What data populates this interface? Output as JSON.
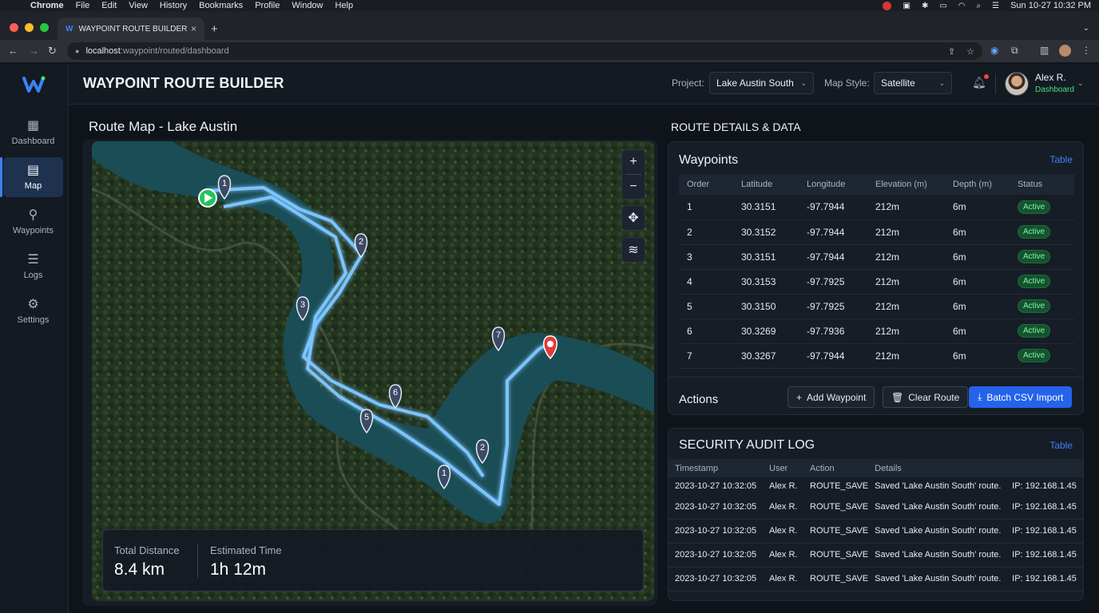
{
  "menubar": {
    "app": "Chrome",
    "items": [
      "File",
      "Edit",
      "View",
      "History",
      "Bookmarks",
      "Profile",
      "Window",
      "Help"
    ],
    "clock": "Sun 10-27  10:32 PM"
  },
  "browser": {
    "tab_title": "WAYPOINT ROUTE BUILDER",
    "url_host": "localhost",
    "url_path": ":waypoint/routed/dashboard"
  },
  "app": {
    "title": "WAYPOINT ROUTE BUILDER",
    "project_label": "Project:",
    "project_value": "Lake Austin South",
    "mapstyle_label": "Map Style:",
    "mapstyle_value": "Satellite",
    "user_name": "Alex R.",
    "user_role": "Dashboard"
  },
  "sidebar": {
    "items": [
      {
        "label": "Dashboard",
        "icon": "dashboard-icon"
      },
      {
        "label": "Map",
        "icon": "map-icon"
      },
      {
        "label": "Waypoints",
        "icon": "location-pin-icon"
      },
      {
        "label": "Logs",
        "icon": "document-icon"
      },
      {
        "label": "Settings",
        "icon": "gear-icon"
      }
    ]
  },
  "map_panel": {
    "title": "Route Map - Lake Austin",
    "total_distance_label": "Total Distance",
    "total_distance_value": "8.4 km",
    "est_time_label": "Estimated Time",
    "est_time_value": "1h 12m",
    "marker_labels": [
      "1",
      "2",
      "3",
      "7",
      "6",
      "5",
      "2",
      "1"
    ]
  },
  "details": {
    "title": "ROUTE DETAILS & DATA",
    "waypoints_title": "Waypoints",
    "waypoints_link": "Table",
    "columns": [
      "Order",
      "Latitude",
      "Longitude",
      "Elevation (m)",
      "Depth (m)",
      "Status"
    ],
    "rows": [
      [
        "1",
        "30.3151",
        "-97.7944",
        "212m",
        "6m",
        "Active"
      ],
      [
        "2",
        "30.3152",
        "-97.7944",
        "212m",
        "6m",
        "Active"
      ],
      [
        "3",
        "30.3151",
        "-97.7944",
        "212m",
        "6m",
        "Active"
      ],
      [
        "4",
        "30.3153",
        "-97.7925",
        "212m",
        "6m",
        "Active"
      ],
      [
        "5",
        "30.3150",
        "-97.7925",
        "212m",
        "6m",
        "Active"
      ],
      [
        "6",
        "30.3269",
        "-97.7936",
        "212m",
        "6m",
        "Active"
      ],
      [
        "7",
        "30.3267",
        "-97.7944",
        "212m",
        "6m",
        "Active"
      ]
    ],
    "actions_label": "Actions",
    "add_waypoint": "Add Waypoint",
    "clear_route": "Clear Route",
    "batch_import": "Batch CSV Import"
  },
  "audit": {
    "title": "SECURITY AUDIT LOG",
    "link": "Table",
    "columns": [
      "Timestamp",
      "User",
      "Action",
      "Details",
      ""
    ],
    "rows": [
      [
        "2023-10-27 10:32:05",
        "Alex R.",
        "ROUTE_SAVE",
        "Saved 'Lake Austin South' route.",
        "IP: 192.168.1.45"
      ],
      [
        "2023-10-27 10:32:05",
        "Alex R.",
        "ROUTE_SAVE",
        "Saved 'Lake Austin South' route.",
        "IP: 192.168.1.45"
      ],
      [
        "2023-10-27 10:32:05",
        "Alex R.",
        "ROUTE_SAVE",
        "Saved 'Lake Austin South' route.",
        "IP: 192.168.1.45"
      ],
      [
        "2023-10-27 10:32:05",
        "Alex R.",
        "ROUTE_SAVE",
        "Saved 'Lake Austin South' route.",
        "IP: 192.168.1.45"
      ],
      [
        "2023-10-27 10:32:05",
        "Alex R.",
        "ROUTE_SAVE",
        "Saved 'Lake Austin South' route.",
        "IP: 192.168.1.45"
      ]
    ]
  },
  "colors": {
    "accent": "#3b82f6",
    "route": "#7cc4ff",
    "active_badge": "#14532d"
  }
}
